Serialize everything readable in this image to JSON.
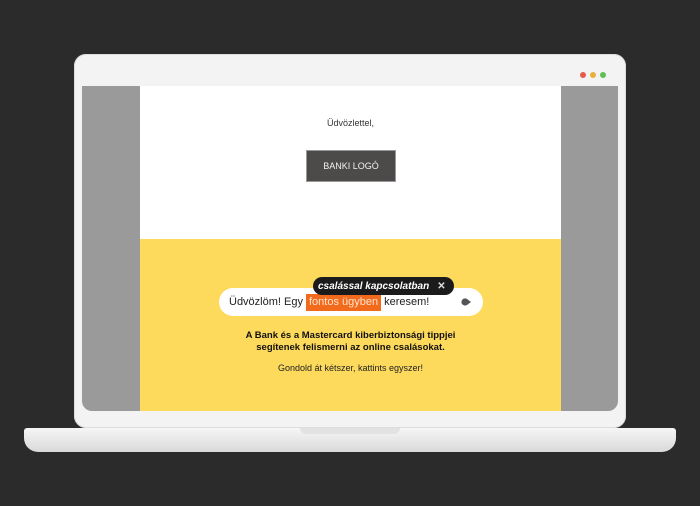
{
  "window": {
    "controls": [
      "close",
      "minimize",
      "maximize"
    ],
    "colors": {
      "close": "#e45c4b",
      "minimize": "#e8b23a",
      "maximize": "#5fbf55"
    }
  },
  "email": {
    "greeting": "Üdvözlettel,",
    "logo_label": "BANKI LOGÓ",
    "tooltip": {
      "text": "csalással kapcsolatban",
      "close_glyph": "✕"
    },
    "search": {
      "before": "Üdvözlöm! Egy",
      "highlight": "fontos ügyben",
      "after": "keresem!",
      "highlight_color": "#f26b1d"
    },
    "headline_line1": "A Bank és a Mastercard kiberbiztonsági tippjei",
    "headline_line2": "segítenek felismerni az online csalásokat.",
    "tagline": "Gondold át kétszer, kattints egyszer!",
    "accent_color": "#fdd95c"
  }
}
